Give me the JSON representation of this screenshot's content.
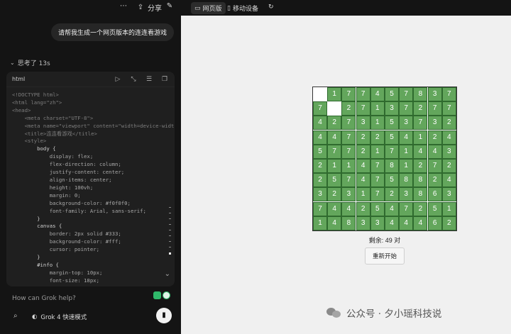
{
  "left_topbar": {
    "more_icon": "more-icon",
    "share_label": "分享",
    "edit_icon": "edit-icon"
  },
  "right_topbar": {
    "tab_web": "网页版",
    "tab_mobile": "移动设备",
    "refresh_icon": "refresh-icon"
  },
  "chat": {
    "user_message": "请帮我生成一个网页版本的连连看游戏",
    "thinking_label": "思考了 13s"
  },
  "code_panel": {
    "language": "html",
    "lines": [
      [
        "tag",
        "<!DOCTYPE html>"
      ],
      [
        "tag",
        "<html lang=\"zh\">"
      ],
      [
        "tag",
        "<head>"
      ],
      [
        "tag",
        "    <meta charset=\"UTF-8\">"
      ],
      [
        "tag",
        "    <meta name=\"viewport\" content=\"width=device-width"
      ],
      [
        "tag",
        "    <title>连连看游戏</title>"
      ],
      [
        "tag",
        "    <style>"
      ],
      [
        "sel",
        "        body {"
      ],
      [
        "prop",
        "            display: flex;"
      ],
      [
        "prop",
        "            flex-direction: column;"
      ],
      [
        "prop",
        "            justify-content: center;"
      ],
      [
        "prop",
        "            align-items: center;"
      ],
      [
        "prop",
        "            height: 100vh;"
      ],
      [
        "prop",
        "            margin: 0;"
      ],
      [
        "prop",
        "            background-color: #f0f0f0;"
      ],
      [
        "prop",
        "            font-family: Arial, sans-serif;"
      ],
      [
        "sel",
        "        }"
      ],
      [
        "sel",
        "        canvas {"
      ],
      [
        "prop",
        "            border: 2px solid #333;"
      ],
      [
        "prop",
        "            background-color: #fff;"
      ],
      [
        "prop",
        "            cursor: pointer;"
      ],
      [
        "sel",
        "        }"
      ],
      [
        "sel",
        "        #info {"
      ],
      [
        "prop",
        "            margin-top: 10px;"
      ],
      [
        "prop",
        "            font-size: 18px;"
      ]
    ]
  },
  "input": {
    "placeholder": "How can Grok help?",
    "model_label": "Grok 4 快速模式"
  },
  "game": {
    "board": [
      [
        null,
        1,
        7,
        7,
        4,
        5,
        7,
        8,
        3,
        7
      ],
      [
        7,
        null,
        2,
        7,
        1,
        3,
        7,
        2,
        7,
        7
      ],
      [
        4,
        2,
        7,
        3,
        1,
        5,
        3,
        7,
        3,
        2
      ],
      [
        4,
        4,
        7,
        2,
        2,
        5,
        4,
        1,
        2,
        4
      ],
      [
        5,
        7,
        7,
        2,
        1,
        7,
        1,
        4,
        4,
        3
      ],
      [
        2,
        1,
        1,
        4,
        7,
        8,
        1,
        2,
        7,
        2
      ],
      [
        2,
        5,
        7,
        4,
        7,
        5,
        8,
        8,
        2,
        4
      ],
      [
        3,
        2,
        3,
        1,
        7,
        2,
        3,
        8,
        6,
        3
      ],
      [
        7,
        4,
        4,
        2,
        5,
        4,
        7,
        2,
        5,
        1
      ],
      [
        1,
        4,
        8,
        3,
        3,
        4,
        4,
        4,
        6,
        2
      ]
    ],
    "remaining_text": "剩余: 49 对",
    "restart_label": "重新开始"
  },
  "watermark": {
    "text": "公众号 · 夕小瑶科技说"
  }
}
